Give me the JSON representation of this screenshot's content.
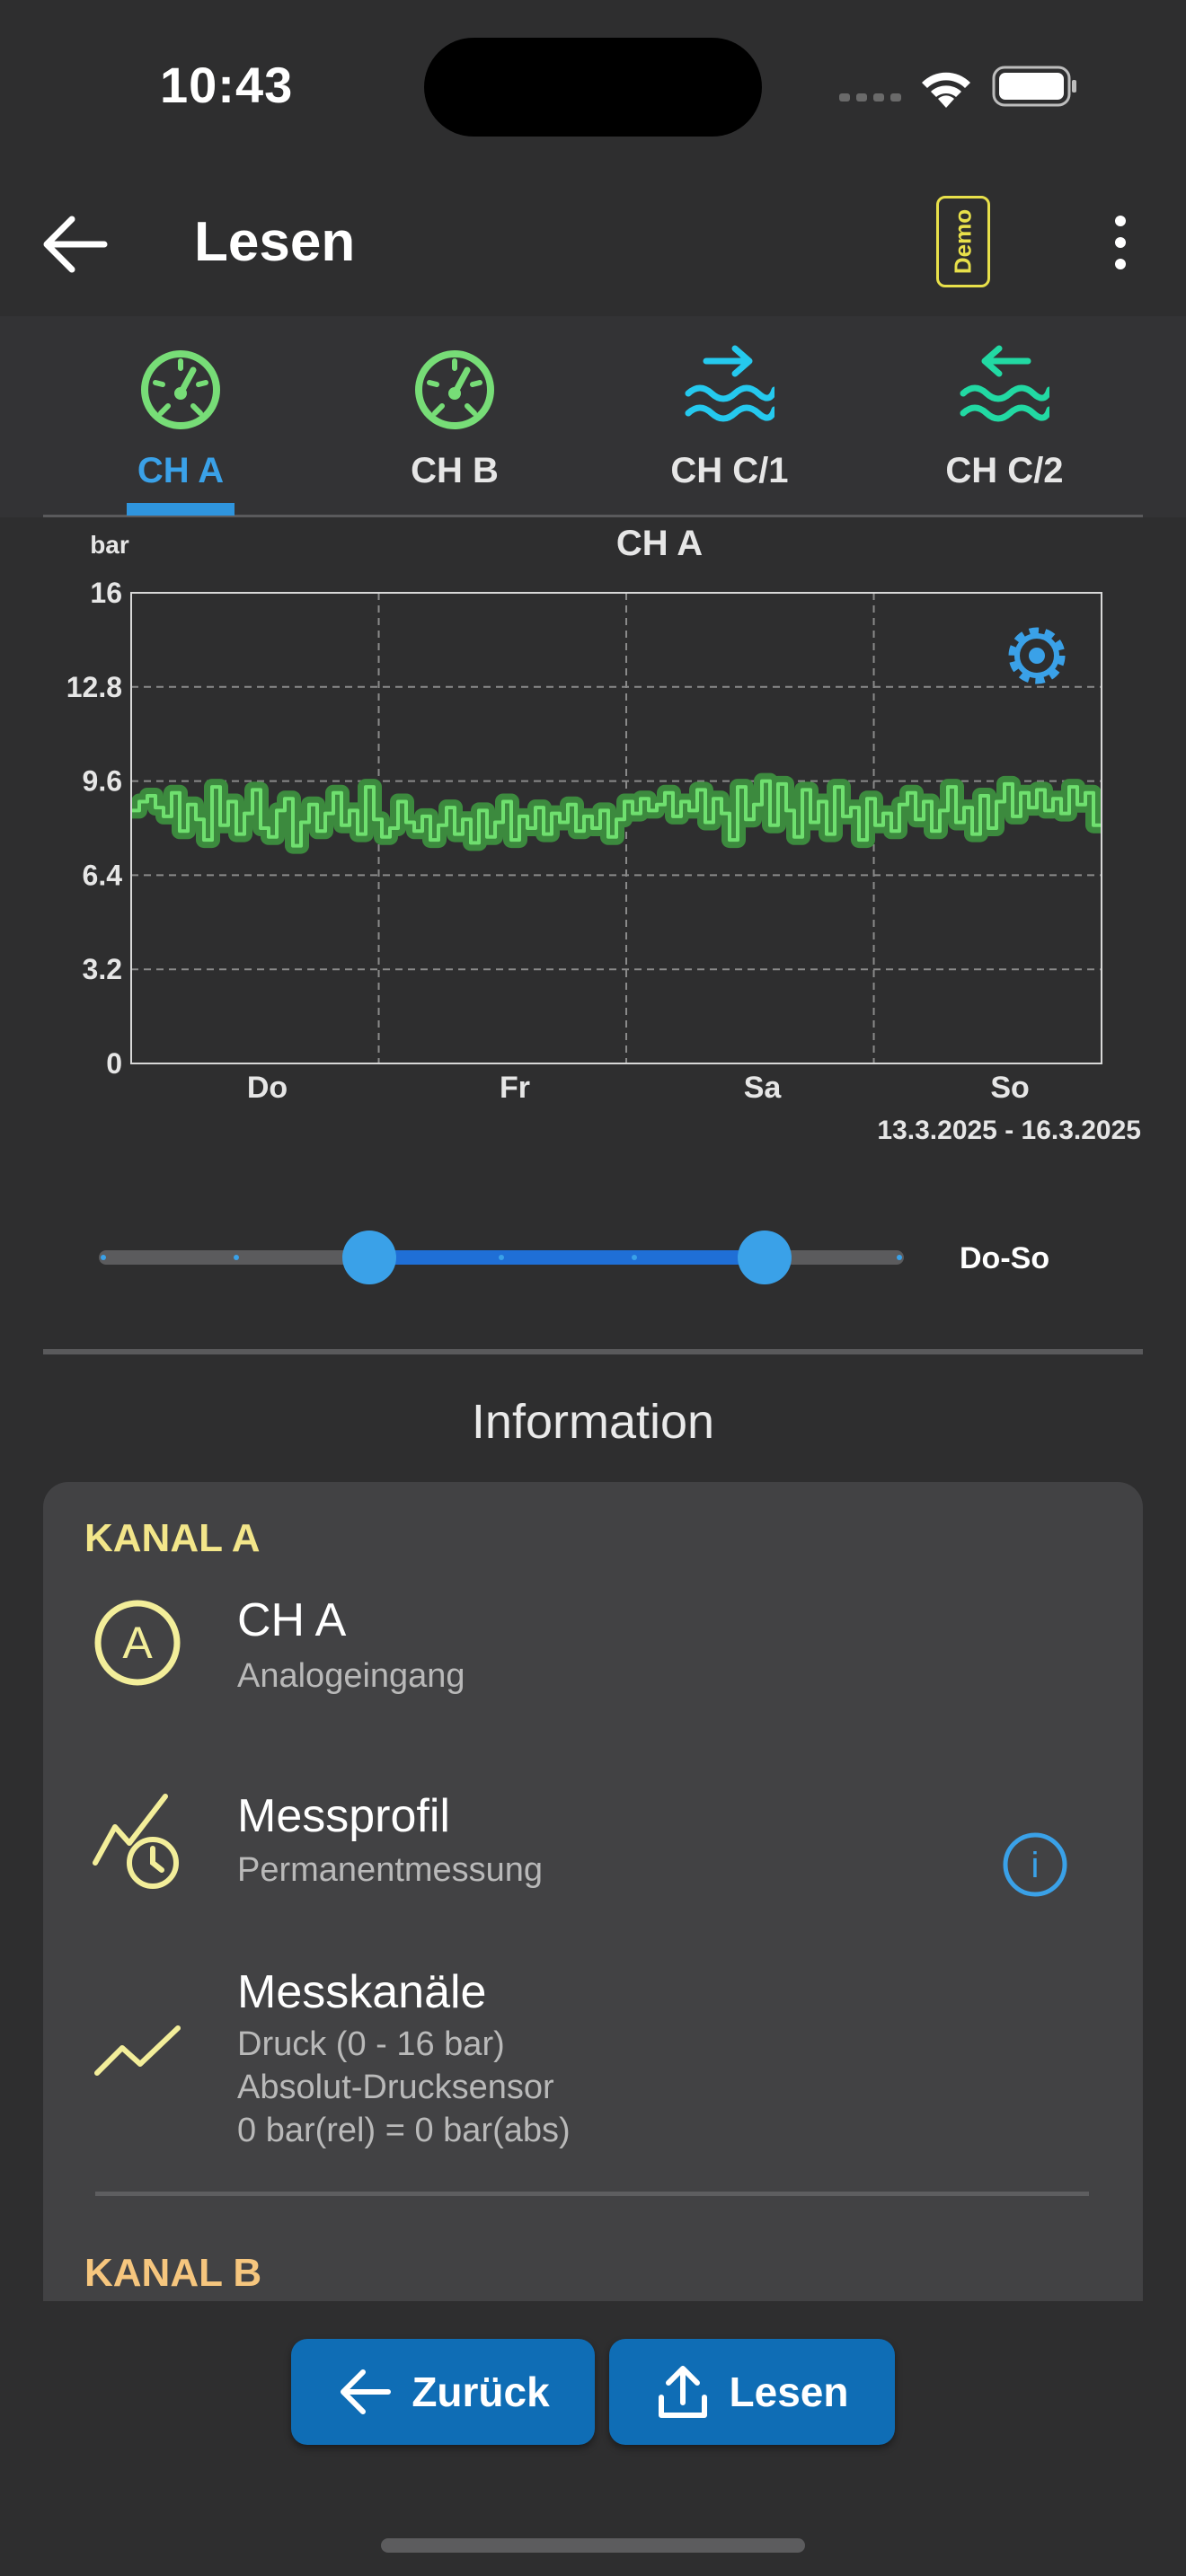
{
  "status_bar": {
    "time": "10:43"
  },
  "app_bar": {
    "title": "Lesen",
    "demo_badge": "Demo"
  },
  "tabs": [
    {
      "label": "CH A",
      "icon": "gauge-icon",
      "color": "#77dd77",
      "active": true
    },
    {
      "label": "CH B",
      "icon": "gauge-icon",
      "color": "#77dd77",
      "active": false
    },
    {
      "label": "CH C/1",
      "icon": "water-in-icon",
      "color": "#25c9ee",
      "active": false
    },
    {
      "label": "CH C/2",
      "icon": "water-out-icon",
      "color": "#22d9a3",
      "active": false
    }
  ],
  "chart_data": {
    "type": "line",
    "title": "CH A",
    "ylabel": "bar",
    "xlabel": "",
    "ylim": [
      0,
      16
    ],
    "yticks": [
      "0",
      "3.2",
      "6.4",
      "9.6",
      "12.8",
      "16"
    ],
    "categories": [
      "Do",
      "Fr",
      "Sa",
      "So"
    ],
    "date_range": "13.3.2025 - 16.3.2025",
    "grid": true,
    "series_color": "#6fe06f",
    "band_color": "#3c8a3e",
    "values": [
      8.6,
      8.9,
      9.1,
      8.7,
      8.4,
      9.2,
      7.9,
      8.8,
      8.3,
      7.6,
      9.4,
      8.1,
      8.9,
      7.8,
      8.5,
      9.3,
      8.0,
      7.7,
      8.6,
      9.0,
      7.4,
      8.2,
      8.8,
      7.9,
      8.5,
      9.2,
      8.1,
      8.6,
      7.8,
      9.4,
      8.3,
      7.7,
      8.0,
      8.9,
      8.2,
      7.9,
      8.4,
      7.6,
      8.1,
      8.7,
      7.8,
      8.3,
      7.5,
      8.6,
      7.7,
      8.2,
      8.9,
      7.6,
      8.4,
      8.0,
      8.7,
      7.8,
      8.5,
      8.2,
      8.8,
      7.9,
      8.4,
      8.0,
      8.6,
      7.7,
      8.3,
      8.9,
      8.5,
      9.0,
      8.6,
      8.8,
      9.2,
      8.4,
      8.9,
      8.6,
      9.3,
      8.2,
      9.0,
      8.5,
      7.6,
      9.4,
      8.3,
      8.8,
      9.6,
      8.1,
      9.5,
      8.6,
      7.7,
      9.3,
      8.2,
      8.9,
      7.8,
      9.4,
      8.4,
      8.7,
      7.6,
      9.0,
      8.1,
      8.5,
      7.9,
      8.8,
      9.2,
      8.3,
      8.9,
      7.9,
      8.6,
      9.4,
      8.2,
      8.7,
      7.8,
      9.1,
      8.0,
      8.9,
      9.5,
      8.4,
      9.2,
      8.7,
      9.3,
      8.6,
      9.0,
      8.5,
      9.4,
      8.8,
      9.2,
      8.1
    ]
  },
  "slider": {
    "range_label": "Do-So",
    "start": 0.333,
    "end": 0.833
  },
  "info": {
    "heading": "Information",
    "kanal_a": "KANAL A",
    "kanal_b": "KANAL B",
    "channel": {
      "title": "CH A",
      "subtitle": "Analogeingang",
      "icon_letter": "A"
    },
    "profile": {
      "title": "Messprofil",
      "subtitle": "Permanentmessung",
      "info_glyph": "i"
    },
    "channels": {
      "title": "Messkanäle",
      "line1": "Druck (0 - 16 bar)",
      "line2": "Absolut-Drucksensor",
      "line3": "0 bar(rel) = 0 bar(abs)"
    }
  },
  "actions": {
    "back_label": "Zurück",
    "read_label": "Lesen"
  },
  "colors": {
    "accent": "#3aa1e8",
    "button": "#0f6db5",
    "kanal_a": "#f3e68a",
    "kanal_b": "#f6c67e",
    "icon_yellow": "#f3ee9a"
  }
}
